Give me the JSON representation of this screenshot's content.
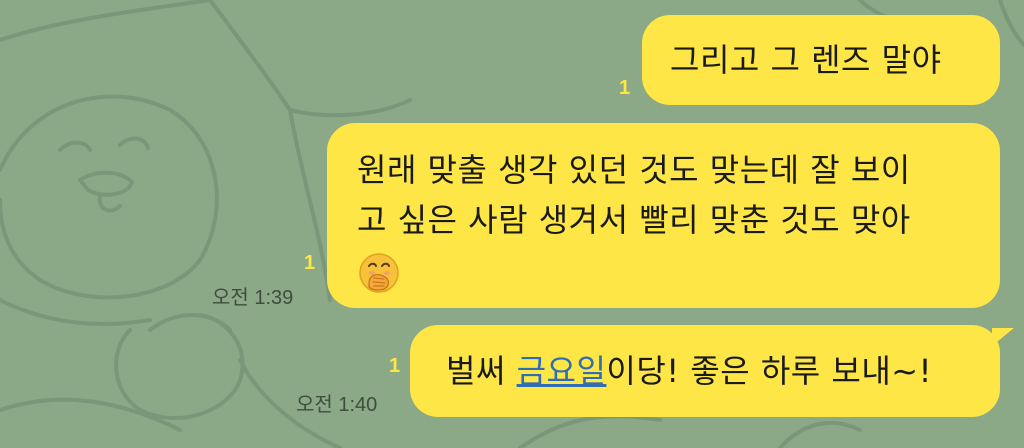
{
  "messages": [
    {
      "lines": [
        "그리고 그 렌즈 말야"
      ],
      "unread": "1"
    },
    {
      "lines": [
        "원래 맞출 생각 있던 것도 맞는데 잘 보이",
        "고 싶은 사람 생겨서 빨리 맞춘 것도 맞아"
      ],
      "emoji": "face-with-hand-over-mouth",
      "unread": "1",
      "time": "오전 1:39"
    },
    {
      "prefix": "벌써 ",
      "link_text": "금요일",
      "suffix": "이당! 좋은 하루 보내~!",
      "unread": "1",
      "time": "오전 1:40"
    }
  ],
  "colors": {
    "background": "#8ba887",
    "bubble": "#fde645",
    "unread": "#fde645",
    "link": "#2f6db5"
  }
}
